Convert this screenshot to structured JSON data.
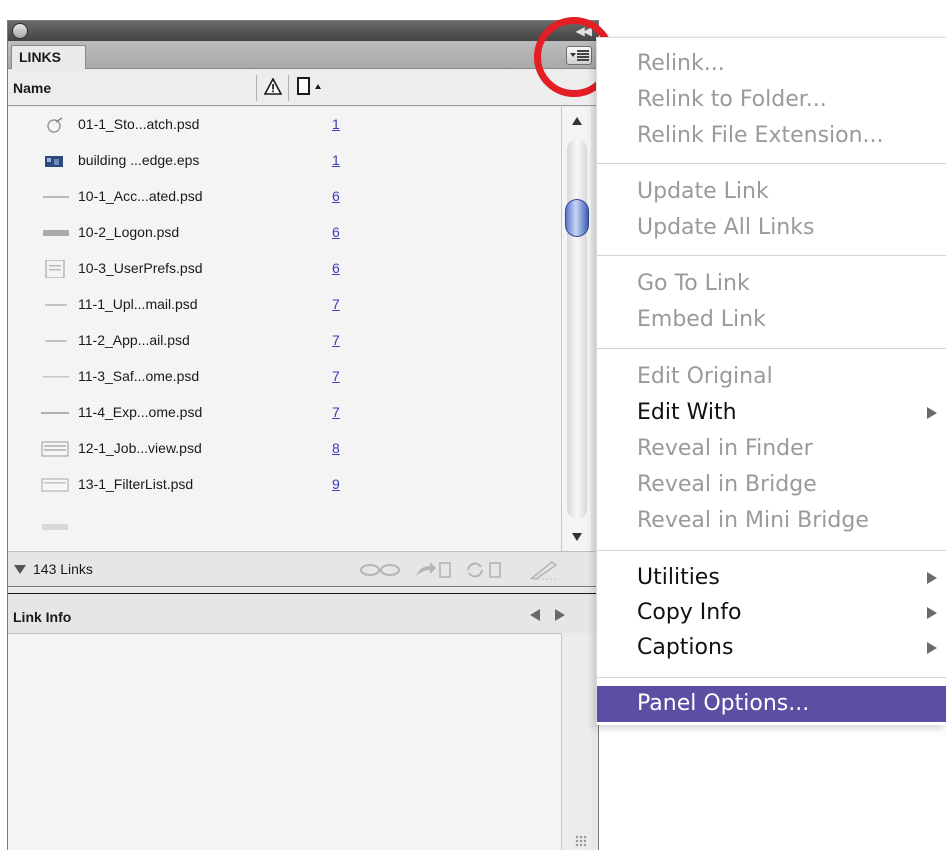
{
  "panel": {
    "tab_label": "LINKS",
    "columns": {
      "name": "Name"
    },
    "rows": [
      {
        "name": "01-1_Sto...atch.psd",
        "page": "1"
      },
      {
        "name": "building ...edge.eps",
        "page": "1"
      },
      {
        "name": "10-1_Acc...ated.psd",
        "page": "6"
      },
      {
        "name": "10-2_Logon.psd",
        "page": "6"
      },
      {
        "name": "10-3_UserPrefs.psd",
        "page": "6"
      },
      {
        "name": "11-1_Upl...mail.psd",
        "page": "7"
      },
      {
        "name": "11-2_App...ail.psd",
        "page": "7"
      },
      {
        "name": "11-3_Saf...ome.psd",
        "page": "7"
      },
      {
        "name": "11-4_Exp...ome.psd",
        "page": "7"
      },
      {
        "name": "12-1_Job...view.psd",
        "page": "8"
      },
      {
        "name": "13-1_FilterList.psd",
        "page": "9"
      }
    ],
    "links_count": "143 Links",
    "link_info_title": "Link Info"
  },
  "menu": {
    "items": [
      {
        "label": "Relink...",
        "enabled": false
      },
      {
        "label": "Relink to Folder...",
        "enabled": false
      },
      {
        "label": "Relink File Extension...",
        "enabled": false
      },
      {
        "label": "Update Link",
        "enabled": false
      },
      {
        "label": "Update All Links",
        "enabled": false
      },
      {
        "label": "Go To Link",
        "enabled": false
      },
      {
        "label": "Embed Link",
        "enabled": false
      },
      {
        "label": "Edit Original",
        "enabled": false
      },
      {
        "label": "Edit With",
        "enabled": true,
        "submenu": true
      },
      {
        "label": "Reveal in Finder",
        "enabled": false
      },
      {
        "label": "Reveal in Bridge",
        "enabled": false
      },
      {
        "label": "Reveal in Mini Bridge",
        "enabled": false
      },
      {
        "label": "Utilities",
        "enabled": true,
        "submenu": true
      },
      {
        "label": "Copy Info",
        "enabled": true,
        "submenu": true
      },
      {
        "label": "Captions",
        "enabled": true,
        "submenu": true
      },
      {
        "label": "Panel Options...",
        "enabled": true,
        "highlighted": true
      }
    ]
  },
  "colors": {
    "menu_highlight": "#5b4fa4",
    "disabled_text": "#9a9a9a",
    "page_link": "#3b3bbd",
    "callout_circle": "#e31e24"
  }
}
